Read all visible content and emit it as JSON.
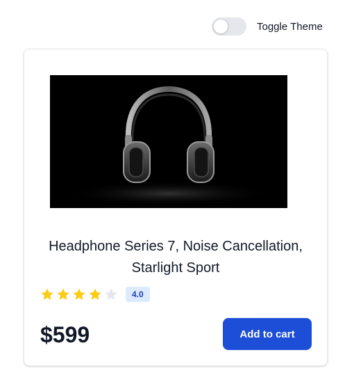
{
  "theme_toggle": {
    "label": "Toggle Theme",
    "state": "off"
  },
  "product": {
    "image_icon": "headphones-photo",
    "title": "Headphone Series 7, Noise Cancellation, Starlight Sport",
    "rating": {
      "value": 4,
      "max": 5,
      "label": "4.0",
      "filled_color": "#facc15",
      "empty_color": "#e5e7eb"
    },
    "price": "$599",
    "add_to_cart_label": "Add to cart",
    "button_color": "#1d4ed8"
  }
}
